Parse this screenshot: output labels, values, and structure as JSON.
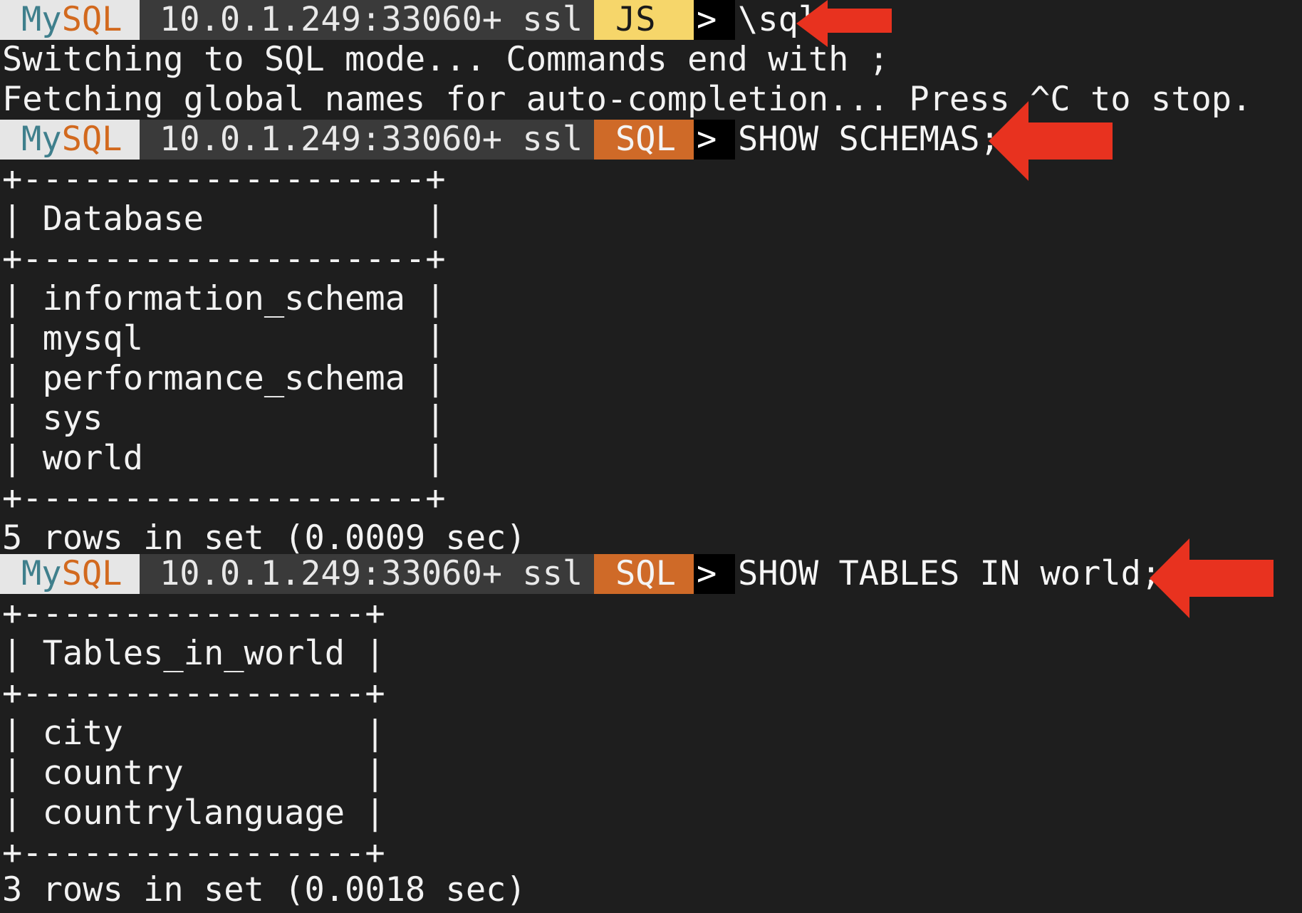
{
  "prompt": {
    "my": "My",
    "sql": "SQL",
    "host": "10.0.1.249:33060+ ssl",
    "gt": ">"
  },
  "block1": {
    "mode": "JS",
    "command": "\\sql",
    "out1": "Switching to SQL mode... Commands end with ;",
    "out2": "Fetching global names for auto-completion... Press ^C to stop."
  },
  "block2": {
    "mode": "SQL",
    "command": "SHOW SCHEMAS;",
    "table_lines": [
      "+--------------------+",
      "| Database           |",
      "+--------------------+",
      "| information_schema |",
      "| mysql              |",
      "| performance_schema |",
      "| sys                |",
      "| world              |",
      "+--------------------+"
    ],
    "result": "5 rows in set (0.0009 sec)"
  },
  "block3": {
    "mode": "SQL",
    "command": "SHOW TABLES IN world;",
    "table_lines": [
      "+-----------------+",
      "| Tables_in_world |",
      "+-----------------+",
      "| city            |",
      "| country         |",
      "| countrylanguage |",
      "+-----------------+"
    ],
    "result": "3 rows in set (0.0018 sec)"
  },
  "colors": {
    "background": "#1e1e1e",
    "arrow": "#e8321f",
    "js_badge": "#f6d66a",
    "sql_badge": "#cf6a28"
  },
  "icons": [
    "arrow-left-icon"
  ]
}
